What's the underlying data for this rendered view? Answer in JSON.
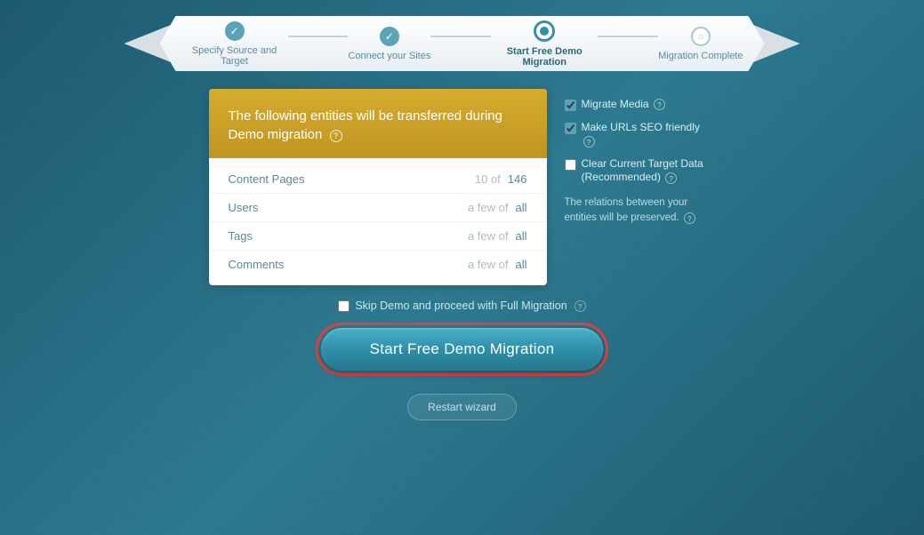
{
  "banner": {
    "steps": [
      {
        "id": "specify",
        "label": "Specify Source and Target",
        "state": "completed"
      },
      {
        "id": "connect",
        "label": "Connect your Sites",
        "state": "completed"
      },
      {
        "id": "start",
        "label": "Start Free Demo Migration",
        "state": "active"
      },
      {
        "id": "complete",
        "label": "Migration Complete",
        "state": "inactive"
      }
    ]
  },
  "entity_box": {
    "header": "The following entities will be transferred during Demo migration",
    "rows": [
      {
        "name": "Content Pages",
        "count_label": "10 of",
        "total": "146"
      },
      {
        "name": "Users",
        "count_label": "a few of",
        "total": "all"
      },
      {
        "name": "Tags",
        "count_label": "a few of",
        "total": "all"
      },
      {
        "name": "Comments",
        "count_label": "a few of",
        "total": "all"
      }
    ]
  },
  "options": {
    "items": [
      {
        "id": "migrate_media",
        "label": "Migrate Media",
        "checked": true
      },
      {
        "id": "seo_friendly",
        "label": "Make URLs SEO friendly",
        "checked": true
      },
      {
        "id": "clear_target",
        "label": "Clear Current Target Data (Recommended)",
        "checked": false
      }
    ],
    "relations_note": "The relations between your entities will be preserved."
  },
  "skip_demo": {
    "label": "Skip Demo and proceed with Full Migration",
    "checked": false
  },
  "start_button": {
    "label": "Start Free Demo Migration"
  },
  "restart_button": {
    "label": "Restart wizard"
  }
}
